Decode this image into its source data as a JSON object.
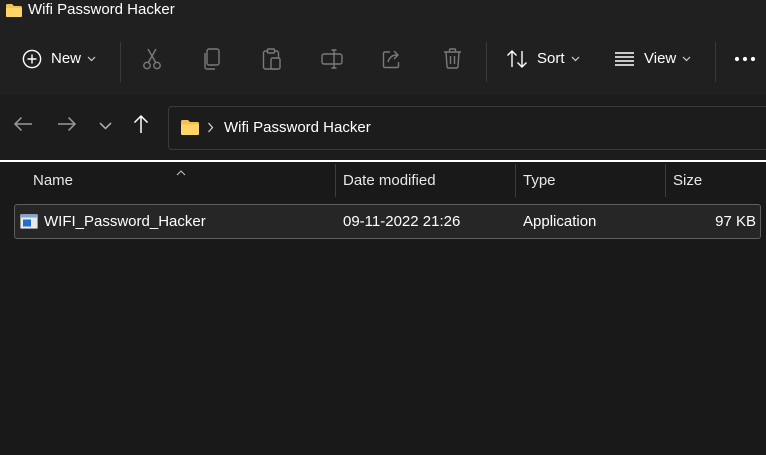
{
  "window": {
    "title": "Wifi Password Hacker"
  },
  "toolbar": {
    "new_label": "New",
    "sort_label": "Sort",
    "view_label": "View",
    "icons": [
      "plus-circle-icon",
      "cut-icon",
      "copy-icon",
      "paste-icon",
      "rename-icon",
      "share-icon",
      "delete-icon",
      "sort-icon",
      "view-icon",
      "more-icon"
    ]
  },
  "address": {
    "path": [
      "Wifi Password Hacker"
    ]
  },
  "columns": [
    "Name",
    "Date modified",
    "Type",
    "Size"
  ],
  "files": [
    {
      "name": "WIFI_Password_Hacker",
      "modified": "09-11-2022 21:26",
      "type": "Application",
      "size": "97 KB"
    }
  ],
  "colors": {
    "folder": "#F2C14E",
    "background": "#191919",
    "toolbar": "#202020",
    "selection_border": "#5e5e5e"
  }
}
